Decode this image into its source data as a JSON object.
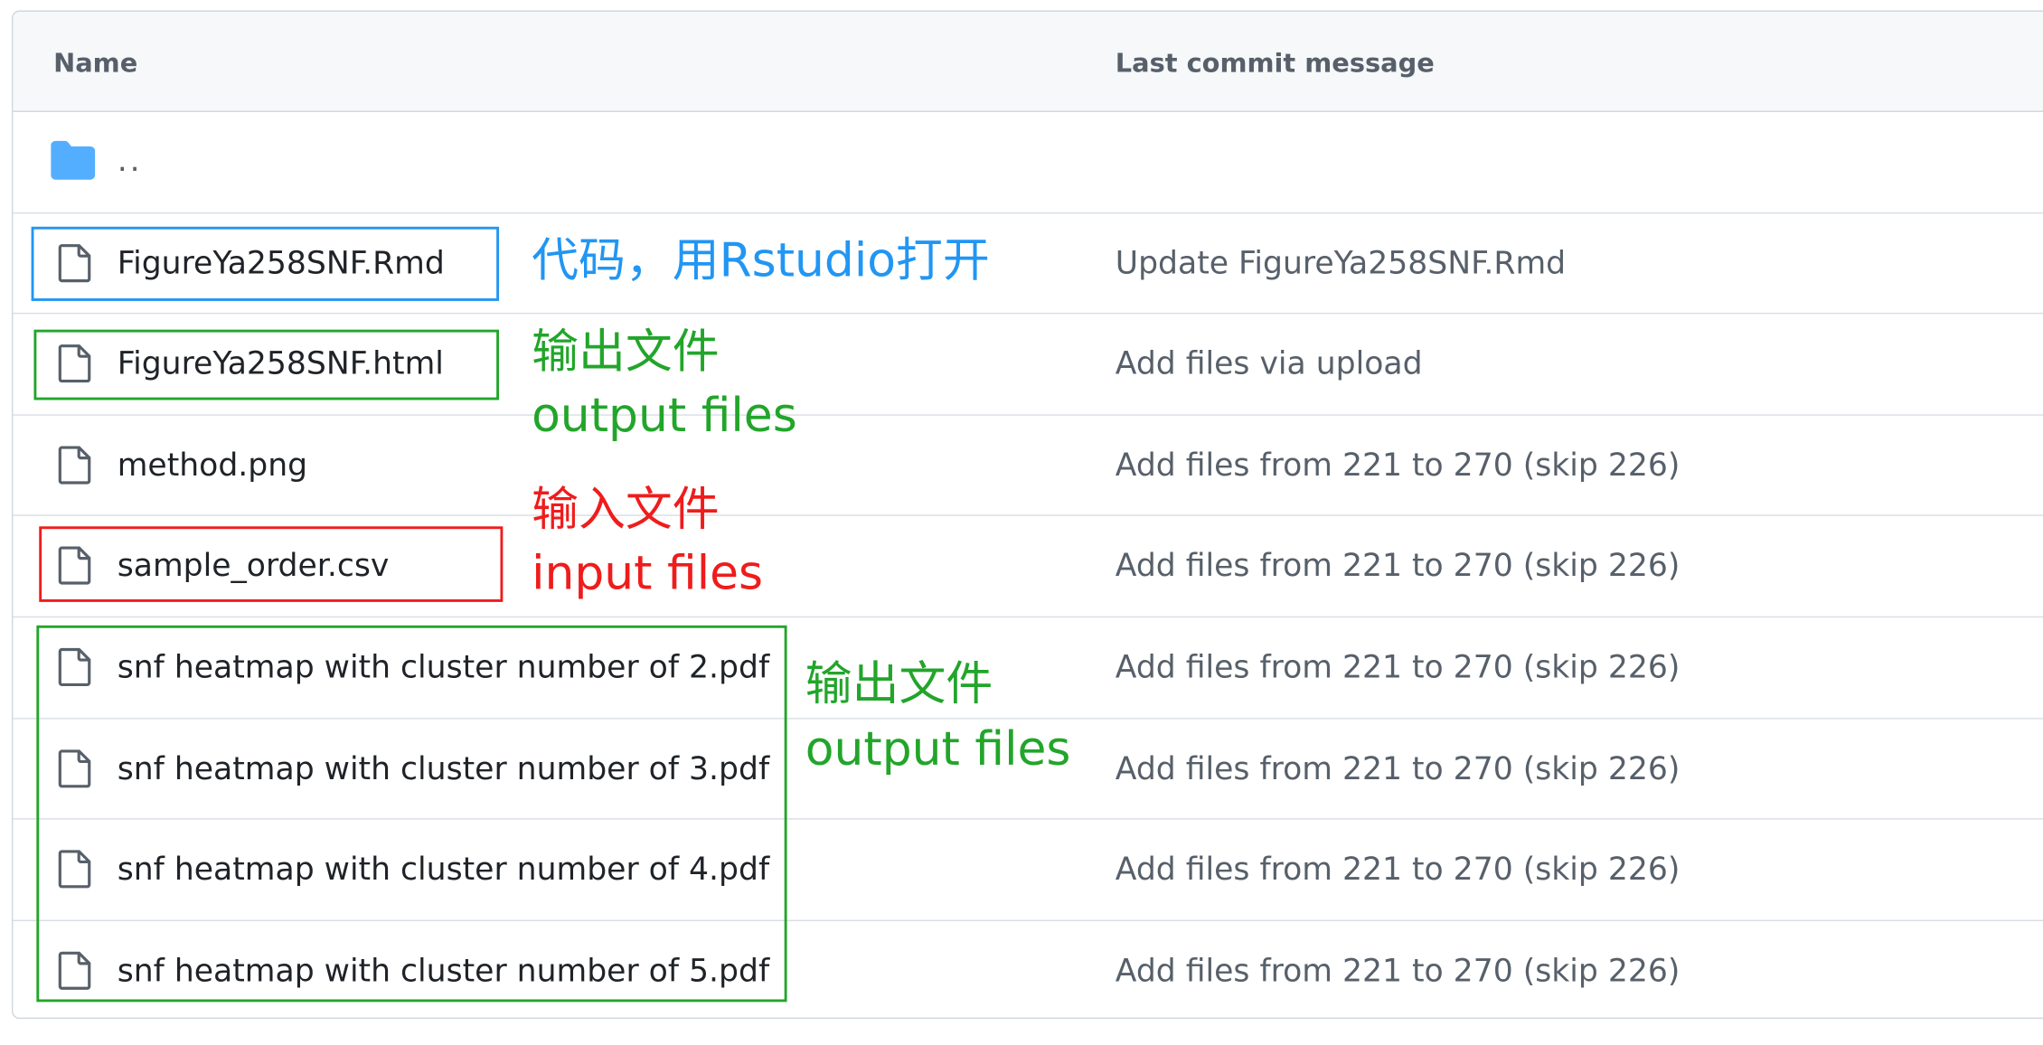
{
  "table": {
    "header": {
      "name": "Name",
      "commit": "Last commit message"
    },
    "parent": {
      "label": ".."
    },
    "rows": [
      {
        "name": "FigureYa258SNF.Rmd",
        "commit": "Update FigureYa258SNF.Rmd"
      },
      {
        "name": "FigureYa258SNF.html",
        "commit": "Add files via upload"
      },
      {
        "name": "method.png",
        "commit": "Add files from 221 to 270 (skip 226)"
      },
      {
        "name": "sample_order.csv",
        "commit": "Add files from 221 to 270 (skip 226)"
      },
      {
        "name": "snf heatmap with cluster number of 2.pdf",
        "commit": "Add files from 221 to 270 (skip 226)"
      },
      {
        "name": "snf heatmap with cluster number of 3.pdf",
        "commit": "Add files from 221 to 270 (skip 226)"
      },
      {
        "name": "snf heatmap with cluster number of 4.pdf",
        "commit": "Add files from 221 to 270 (skip 226)"
      },
      {
        "name": "snf heatmap with cluster number of 5.pdf",
        "commit": "Add files from 221 to 270 (skip 226)"
      }
    ]
  },
  "annotations": {
    "code": "代码，用Rstudio打开",
    "output1_cn": "输出文件",
    "output1_en": "output files",
    "input_cn": "输入文件",
    "input_en": "input files",
    "output2_cn": "输出文件",
    "output2_en": "output files"
  },
  "colors": {
    "folder": "#54aeff",
    "file_icon": "#57606a",
    "anno_blue": "#2196f3",
    "anno_green": "#22a52a",
    "anno_red": "#ef1c1c"
  },
  "icons": {
    "folder": "folder-icon",
    "file": "file-icon"
  }
}
